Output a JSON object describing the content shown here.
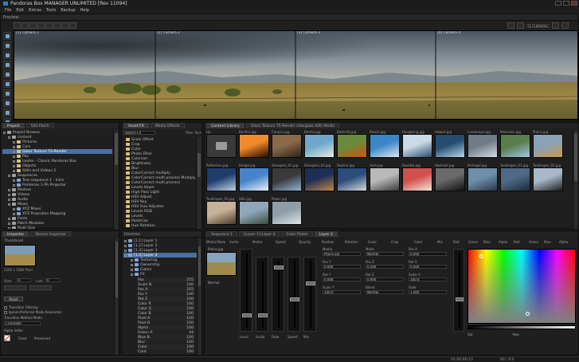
{
  "window": {
    "title": "Pandoras Box MANAGER UNLIMITED [Rev 11094]"
  },
  "menu": {
    "items": [
      "File",
      "Edit",
      "Extras",
      "Tools",
      "Backup",
      "Help"
    ]
  },
  "preview": {
    "panel_title": "Preview",
    "cameras": [
      "[1] Camera 1",
      "[2] Camera 2",
      "[3] Camera 3",
      "[4] Camera 4"
    ],
    "view_select": "[1] Camera1",
    "toolbar_buttons": [
      "select",
      "move",
      "rotate",
      "scale",
      "zoom",
      "snap",
      "grid",
      "fit"
    ],
    "side_buttons": [
      "layers",
      "move",
      "pan",
      "select",
      "snap",
      "gizmo",
      "camera",
      "light",
      "hand",
      "mask"
    ]
  },
  "project_panel": {
    "tabs": [
      "Project",
      "Site Patch"
    ],
    "tree": [
      {
        "label": "Project Browse",
        "depth": 0,
        "kind": "gray"
      },
      {
        "label": "content",
        "depth": 1,
        "kind": "gray"
      },
      {
        "label": "Pictures",
        "depth": 2,
        "kind": "folder"
      },
      {
        "label": "Cars",
        "depth": 2,
        "kind": "folder"
      },
      {
        "label": "Glass Texture TS-Render",
        "depth": 2,
        "kind": "folder",
        "selected": true
      },
      {
        "label": "Pax",
        "depth": 2,
        "kind": "folder"
      },
      {
        "label": "Lauter - Classic Pandoras Box",
        "depth": 2,
        "kind": "folder"
      },
      {
        "label": "Objects",
        "depth": 2,
        "kind": "folder"
      },
      {
        "label": "Stills and Videos 2",
        "depth": 2,
        "kind": "folder"
      },
      {
        "label": "Sequences",
        "depth": 1,
        "kind": "gray"
      },
      {
        "label": "Test sequence 1 - Intro",
        "depth": 2,
        "kind": "blue"
      },
      {
        "label": "ProSeries 1-Ph Projector",
        "depth": 2,
        "kind": "blue"
      },
      {
        "label": "Meshes",
        "depth": 1,
        "kind": "gray"
      },
      {
        "label": "Videos",
        "depth": 1,
        "kind": "gray"
      },
      {
        "label": "Audio",
        "depth": 1,
        "kind": "gray"
      },
      {
        "label": "Mixes",
        "depth": 1,
        "kind": "gray"
      },
      {
        "label": "XYZ Mixes",
        "depth": 2,
        "kind": "blue"
      },
      {
        "label": "XYZ Projection Mapping",
        "depth": 2,
        "kind": "blue"
      },
      {
        "label": "Fonts",
        "depth": 1,
        "kind": "gray"
      },
      {
        "label": "Patch Modules",
        "depth": 1,
        "kind": "gray"
      },
      {
        "label": "Multi-Size",
        "depth": 1,
        "kind": "gray"
      }
    ]
  },
  "asset_panel": {
    "tabs": [
      "Asset FX",
      "Media Effects"
    ],
    "search_placeholder": "Search FX",
    "filter_label": "Filter Tech",
    "tree": [
      {
        "label": "Scale Offset",
        "depth": 0
      },
      {
        "label": "Crop",
        "depth": 0
      },
      {
        "label": "Color",
        "depth": 0
      },
      {
        "label": "Photo Filter",
        "depth": 0
      },
      {
        "label": "Colorizer",
        "depth": 0
      },
      {
        "label": "Brightness",
        "depth": 0
      },
      {
        "label": "Blur",
        "depth": 0
      },
      {
        "label": "ColorCorrect multiply",
        "depth": 0
      },
      {
        "label": "ColorCorrect multi process Multiply",
        "depth": 0
      },
      {
        "label": "ColorCorrect multi process",
        "depth": 0
      },
      {
        "label": "Levels Keyer",
        "depth": 0
      },
      {
        "label": "High Pass Light",
        "depth": 0
      },
      {
        "label": "HSV Adjust",
        "depth": 0
      },
      {
        "label": "HSV Key",
        "depth": 0
      },
      {
        "label": "HSV Hue Adjuster",
        "depth": 0
      },
      {
        "label": "Levels RGB",
        "depth": 0
      },
      {
        "label": "Levels",
        "depth": 0
      },
      {
        "label": "Posterize",
        "depth": 0
      },
      {
        "label": "Hue Rotation",
        "depth": 0
      },
      {
        "label": "Saturation",
        "depth": 0
      }
    ]
  },
  "thumbs_panel": {
    "tabs": [
      "Content Library",
      "Glass Texture TS-Render (stargaze A/B) Media"
    ],
    "items": [
      {
        "label": "Up",
        "color1": "#4d4d4d",
        "color2": "#2c2c2c"
      },
      {
        "label": "Bonfire.jpg",
        "color1": "#f08a2a",
        "color2": "#2a0d02"
      },
      {
        "label": "Canyon.jpg",
        "color1": "#8a6a4a",
        "color2": "#2f2218"
      },
      {
        "label": "Bromo.jpg",
        "color1": "#6da7c9",
        "color2": "#e9ece6"
      },
      {
        "label": "Butterfly.jpg",
        "color1": "#6b8b3a",
        "color2": "#d05212"
      },
      {
        "label": "Beach.jpg",
        "color1": "#3a86c8",
        "color2": "#dfe6ee"
      },
      {
        "label": "Hongkong.jpg",
        "color1": "#c9dbe8",
        "color2": "#2c4c6c"
      },
      {
        "label": "Hobart.jpg",
        "color1": "#264d6f",
        "color2": "#b9d6ec"
      },
      {
        "label": "Landscape.jpg",
        "color1": "#6f7b86",
        "color2": "#d6dbe1"
      },
      {
        "label": "Mountain.jpg",
        "color1": "#5a7d4c",
        "color2": "#9ec7e6"
      },
      {
        "label": "Plains.jpg",
        "color1": "#8aa1b6",
        "color2": "#c79a4a"
      },
      {
        "label": "Reflection.jpg",
        "color1": "#1e3d6b",
        "color2": "#bcd3e6"
      },
      {
        "label": "Bridge.jpg",
        "color1": "#4683c9",
        "color2": "#e9f1f8"
      },
      {
        "label": "Shanghai_01.jpg",
        "color1": "#3a3a3a",
        "color2": "#8fb4d4"
      },
      {
        "label": "Shanghai_02.jpg",
        "color1": "#1d2f56",
        "color2": "#c08a4a"
      },
      {
        "label": "Skyline.jpg",
        "color1": "#2a4d7b",
        "color2": "#d8d8d8"
      },
      {
        "label": "Arch.jpg",
        "color1": "#b9b9b9",
        "color2": "#3a3a3a"
      },
      {
        "label": "Rosette.jpg",
        "color1": "#d05050",
        "color2": "#f0e8d8"
      },
      {
        "label": "Abstract.jpg",
        "color1": "#6a6a6a",
        "color2": "#111111"
      },
      {
        "label": "Portugal.jpg",
        "color1": "#6f8fa8",
        "color2": "#2a3a4a"
      },
      {
        "label": "Tuebingen_01.jpg",
        "color1": "#4e6a86",
        "color2": "#1d2d3d"
      },
      {
        "label": "Tuebingen_02.jpg",
        "color1": "#a8b8c8",
        "color2": "#202020"
      },
      {
        "label": "Tuebingen_03.jpg",
        "color1": "#c7b39a",
        "color2": "#4a3a2a"
      },
      {
        "label": "Hills.jpg",
        "color1": "#8fa7b9",
        "color2": "#3a4a3a"
      },
      {
        "label": "Peaks.jpg",
        "color1": "#8e9ea8",
        "color2": "#dfe6ea"
      }
    ]
  },
  "inspector_panel": {
    "tabs": [
      "Inspector",
      "Device Inspector"
    ],
    "header": "Thumbnail",
    "resolution": "2560 x 1080 Pixel",
    "fields": [
      {
        "label": "Start",
        "value": "0"
      },
      {
        "label": "Last",
        "value": "0"
      }
    ],
    "reset_label": "Reset",
    "options": [
      "Transition Filtering",
      "Ignore Preferred Mode Resolution"
    ],
    "mode_label": "Transition Method Mode",
    "mode_value": "Crossfade",
    "alpha_label": "Alpha Index",
    "bottom_labels": [
      "Fixed",
      "Preserved"
    ]
  },
  "devices_panel": {
    "title": "Devices",
    "tree": [
      {
        "label": "[1.1] Layer 1",
        "depth": 0
      },
      {
        "label": "[1.2] Layer 2",
        "depth": 0
      },
      {
        "label": "[1.3] Layer 3",
        "depth": 0
      },
      {
        "label": "[1.4] Layer 4",
        "depth": 0,
        "selected": true
      },
      {
        "label": "Texturing",
        "depth": 1
      },
      {
        "label": "Ownership",
        "depth": 1
      },
      {
        "label": "Colors",
        "depth": 1
      },
      {
        "label": "FX",
        "depth": 1
      }
    ],
    "params": [
      {
        "label": "Pos",
        "value": "255"
      },
      {
        "label": "Scale N",
        "value": "100"
      },
      {
        "label": "Pos X",
        "value": "255"
      },
      {
        "label": "Pos Y",
        "value": "100"
      },
      {
        "label": "Rot Z",
        "value": "100"
      },
      {
        "label": "Color R",
        "value": "100"
      },
      {
        "label": "Color G",
        "value": "100"
      },
      {
        "label": "Color B",
        "value": "100"
      },
      {
        "label": "Pixel A",
        "value": "100"
      },
      {
        "label": "Pixel B",
        "value": "100"
      },
      {
        "label": "Alpha",
        "value": "100"
      },
      {
        "label": "Green A",
        "value": "44"
      },
      {
        "label": "Blue B",
        "value": "100"
      }
    ],
    "fx_rows": [
      {
        "label": "Blur",
        "value": "100"
      },
      {
        "label": "Color",
        "value": "100"
      },
      {
        "label": "Cont",
        "value": "100"
      },
      {
        "label": "Bright",
        "value": "100"
      }
    ]
  },
  "layer_panel": {
    "tabs": [
      "Sequence 1",
      "[Layer 1] Layer 4",
      "Color Picker",
      "Layer 3"
    ],
    "sections": [
      "Media",
      "Fader",
      "Position",
      "Rotation",
      "Scale",
      "Color"
    ],
    "media_name": "Plains.jpg",
    "col_headers": [
      "Media Mode",
      "Audio",
      "Media",
      "Speed",
      "Opacity",
      "Position",
      "Rotation",
      "Scale",
      "Crop",
      "Color",
      "Mix"
    ],
    "fields": [
      {
        "label": "Media",
        "value": "Plains.jpg"
      },
      {
        "label": "Mode",
        "value": "Normal"
      },
      {
        "label": "Pos X",
        "value": "0.000"
      },
      {
        "label": "Pos Y",
        "value": "0.000"
      },
      {
        "label": "Pos Z",
        "value": "0.000"
      },
      {
        "label": "Rot X",
        "value": "0.000"
      },
      {
        "label": "Rot Y",
        "value": "0.000"
      },
      {
        "label": "Rot Z",
        "value": "0.000"
      },
      {
        "label": "Scale X",
        "value": "100.0"
      },
      {
        "label": "Scale Y",
        "value": "100.0"
      },
      {
        "label": "Blend",
        "value": "Normal"
      },
      {
        "label": "Fade",
        "value": "1.000"
      }
    ],
    "fader_labels": [
      "Level",
      "Audio",
      "Fade",
      "Speed",
      "Mix"
    ],
    "color_headers": [
      "Red",
      "Green",
      "Blue",
      "Alpha",
      "Red",
      "Green",
      "Blue",
      "Alpha"
    ],
    "picker_labels": [
      "Sat",
      "Hue"
    ]
  },
  "status": {
    "time": "01:00:00:12",
    "fps": "60 / 0:0"
  },
  "colors": {
    "accent": "#4a6fa0",
    "panel": "#1f1f1f",
    "header": "#262626"
  }
}
